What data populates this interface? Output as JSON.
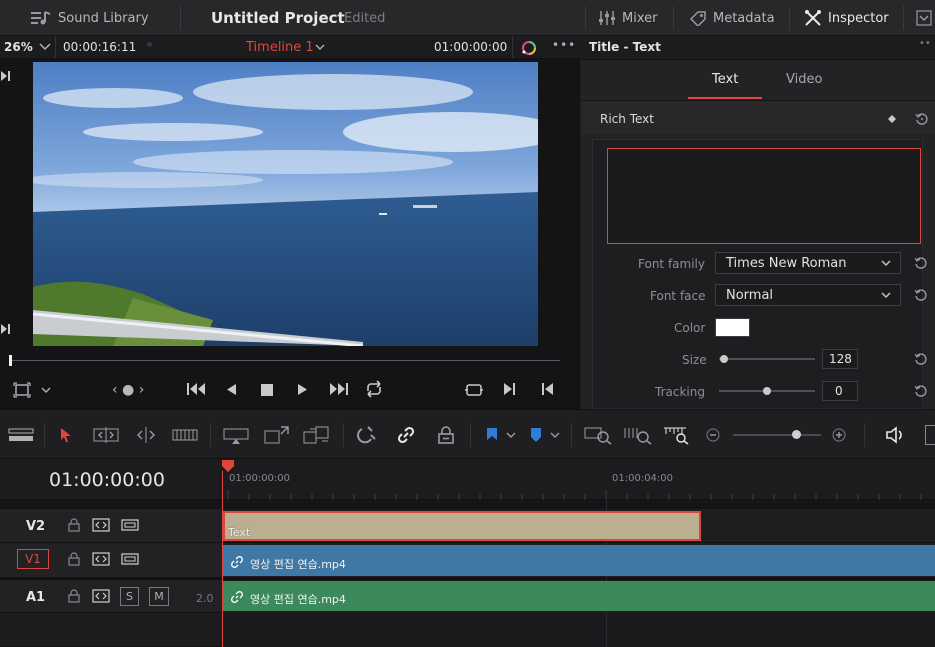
{
  "topbar": {
    "sound_library": "Sound Library",
    "project_title": "Untitled Project",
    "project_status": "Edited",
    "mixer": "Mixer",
    "metadata": "Metadata",
    "inspector": "Inspector"
  },
  "viewer": {
    "zoom": "26%",
    "duration": "00:00:16:11",
    "timeline_name": "Timeline 1",
    "timecode": "01:00:00:00"
  },
  "inspector": {
    "header": "Title - Text",
    "tabs": [
      "Text",
      "Video"
    ],
    "section": "Rich Text",
    "font_family_label": "Font family",
    "font_family_value": "Times New Roman",
    "font_face_label": "Font face",
    "font_face_value": "Normal",
    "color_label": "Color",
    "size_label": "Size",
    "size_value": "128",
    "tracking_label": "Tracking",
    "tracking_value": "0",
    "size_slider_level": 0.05,
    "tracking_slider_level": 0.5
  },
  "timeline": {
    "timecode": "01:00:00:00",
    "ruler": [
      "01:00:00:00",
      "01:00:04:00"
    ],
    "tracks": [
      {
        "name": "V2"
      },
      {
        "name": "V1"
      },
      {
        "name": "A1",
        "solo": "S",
        "mute": "M",
        "channels": "2.0"
      }
    ],
    "clips": {
      "title_clip": "Text",
      "video_clip": "영상 편집 연습.mp4",
      "audio_clip": "영상 편집 연습.mp4"
    }
  },
  "colors": {
    "accent_red": "#e0463c",
    "title_clip": "#bcae91",
    "video_clip": "#3f77a5",
    "audio_clip": "#3c8a5b"
  }
}
